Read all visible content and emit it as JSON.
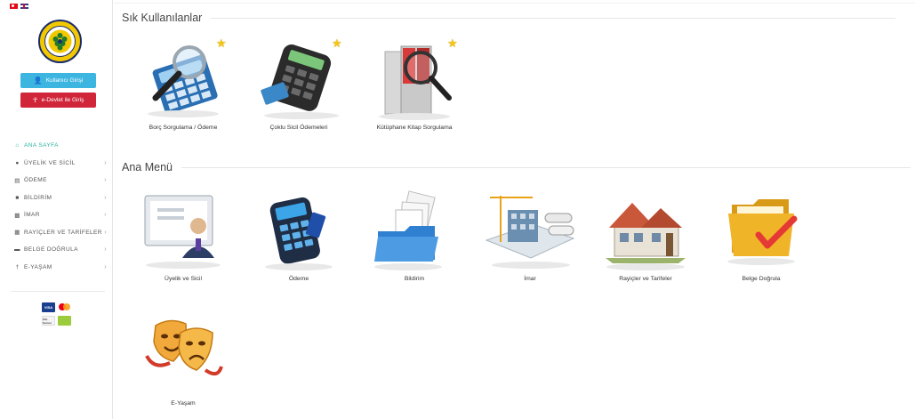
{
  "sidebar": {
    "login_button": "Kullanıcı Girişi",
    "edevlet_button": "e-Devlet ile Giriş",
    "nav": [
      {
        "label": "ANA SAYFA",
        "icon": "home-icon",
        "active": true,
        "arrow": ""
      },
      {
        "label": "ÜYELİK VE SİCİL",
        "icon": "user-icon",
        "active": false,
        "arrow": "›"
      },
      {
        "label": "ÖDEME",
        "icon": "card-icon",
        "active": false,
        "arrow": "›"
      },
      {
        "label": "BİLDİRİM",
        "icon": "document-icon",
        "active": false,
        "arrow": "›"
      },
      {
        "label": "İMAR",
        "icon": "building-icon",
        "active": false,
        "arrow": "›"
      },
      {
        "label": "RAYİÇLER VE TARİFELER",
        "icon": "calculator-icon",
        "active": false,
        "arrow": "›"
      },
      {
        "label": "BELGE DOĞRULA",
        "icon": "folder-icon",
        "active": false,
        "arrow": "›"
      },
      {
        "label": "E-YAŞAM",
        "icon": "person-icon",
        "active": false,
        "arrow": "›"
      }
    ],
    "payment_cards": {
      "visa": "VISA",
      "secure": "SSL Secure"
    }
  },
  "favorites": {
    "title": "Sık Kullanılanlar",
    "items": [
      {
        "label": "Borç Sorgulama / Ödeme"
      },
      {
        "label": "Çoklu Sicil Ödemeleri"
      },
      {
        "label": "Kütüphane Kitap Sorgulama"
      }
    ]
  },
  "main_menu": {
    "title": "Ana Menü",
    "items": [
      {
        "label": "Üyelik ve Sicil"
      },
      {
        "label": "Ödeme"
      },
      {
        "label": "Bildirim"
      },
      {
        "label": "İmar"
      },
      {
        "label": "Rayiçler ve Tarifeler"
      },
      {
        "label": "Belge Doğrula"
      },
      {
        "label": "E-Yaşam"
      }
    ]
  },
  "colors": {
    "accent_teal": "#29b59e",
    "login_blue": "#3cb5e0",
    "edevlet_red": "#d1263a",
    "star_yellow": "#f5c518"
  }
}
